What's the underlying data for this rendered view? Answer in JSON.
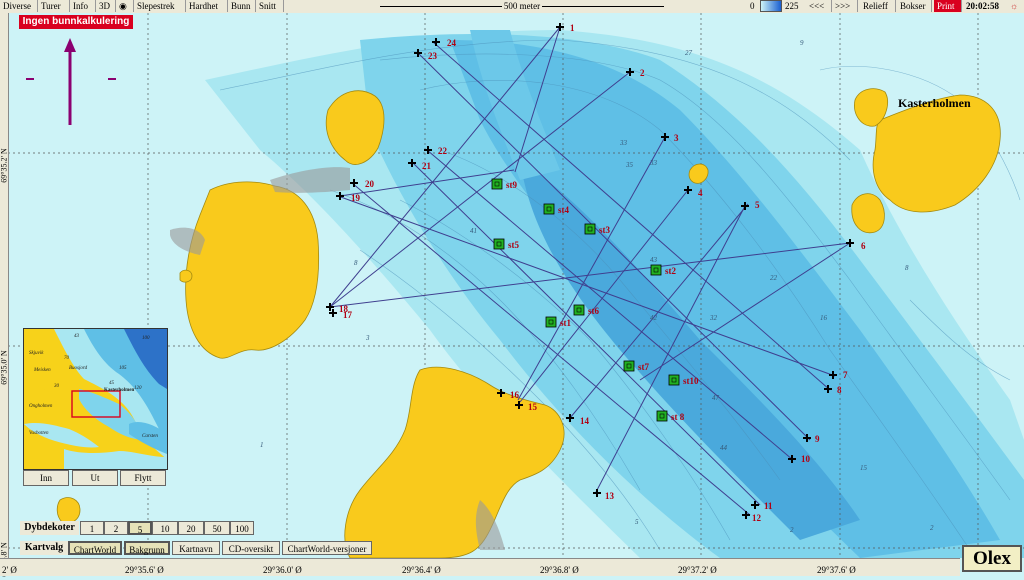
{
  "toolbar": {
    "items": [
      "Diverse",
      "Turer",
      "Info",
      "3D",
      "Slepestrek",
      "Hardhet",
      "Bunn",
      "Snitt"
    ],
    "scale_label": "500 meter",
    "depth_min": "0",
    "depth_max": "225",
    "prev_label": "<<<",
    "next_label": ">>>",
    "relief_label": "Relieff",
    "boxes_label": "Bokser",
    "print_label": "Print",
    "clock": "20:02:58"
  },
  "warning": "Ingen bunnkalkulering",
  "place_name": "Kasterholmen",
  "stations": [
    "st9",
    "st4",
    "st5",
    "st3",
    "st2",
    "st6",
    "st1",
    "st7",
    "st10",
    "st 8"
  ],
  "waypoints": [
    "1",
    "2",
    "3",
    "4",
    "5",
    "6",
    "7",
    "8",
    "9",
    "10",
    "11",
    "12",
    "13",
    "14",
    "15",
    "16",
    "17",
    "18",
    "19",
    "20",
    "21",
    "22",
    "23",
    "24"
  ],
  "depth_soundings": [
    "27",
    "9",
    "33",
    "35",
    "8",
    "41",
    "22",
    "43",
    "3",
    "42",
    "1",
    "16",
    "33",
    "15",
    "8",
    "5",
    "2",
    "2",
    "32",
    "44",
    "47"
  ],
  "minimap": {
    "buttons": [
      "Inn",
      "Ut",
      "Flytt"
    ],
    "labels": [
      "43",
      "70",
      "100",
      "105",
      "45",
      "120",
      "30",
      "Kasterholmen",
      "Buosjord",
      "Skjuvik",
      "Meisken",
      "Ongholmen",
      "Vasbotten",
      "Carsten"
    ]
  },
  "depth_contours": {
    "label": "Dybdekoter",
    "options": [
      "1",
      "2",
      "5",
      "10",
      "20",
      "50",
      "100"
    ],
    "selected": "5"
  },
  "chart_select": {
    "label": "Kartvalg",
    "options": [
      "ChartWorld",
      "Bakgrunn",
      "Kartnavn",
      "CD-oversikt",
      "ChartWorld-versjoner"
    ]
  },
  "axes": {
    "lon_ticks": [
      "29°35.6' Ø",
      "29°36.0' Ø",
      "29°36.4' Ø",
      "29°36.8' Ø",
      "29°37.2' Ø",
      "29°37.6' Ø"
    ],
    "lon_partial": "2' Ø",
    "lat_ticks": [
      "69°35.2' N",
      "69°35.0' N",
      "69°34.8' N"
    ]
  },
  "logo": "Olex",
  "colors": {
    "land": "#f9ca1c",
    "shallow": "#d2f5f8",
    "mid": "#7fd8ec",
    "deep": "#4fb4e0",
    "track": "#3f3f8f",
    "station": "#21b121",
    "label": "#b00012"
  }
}
